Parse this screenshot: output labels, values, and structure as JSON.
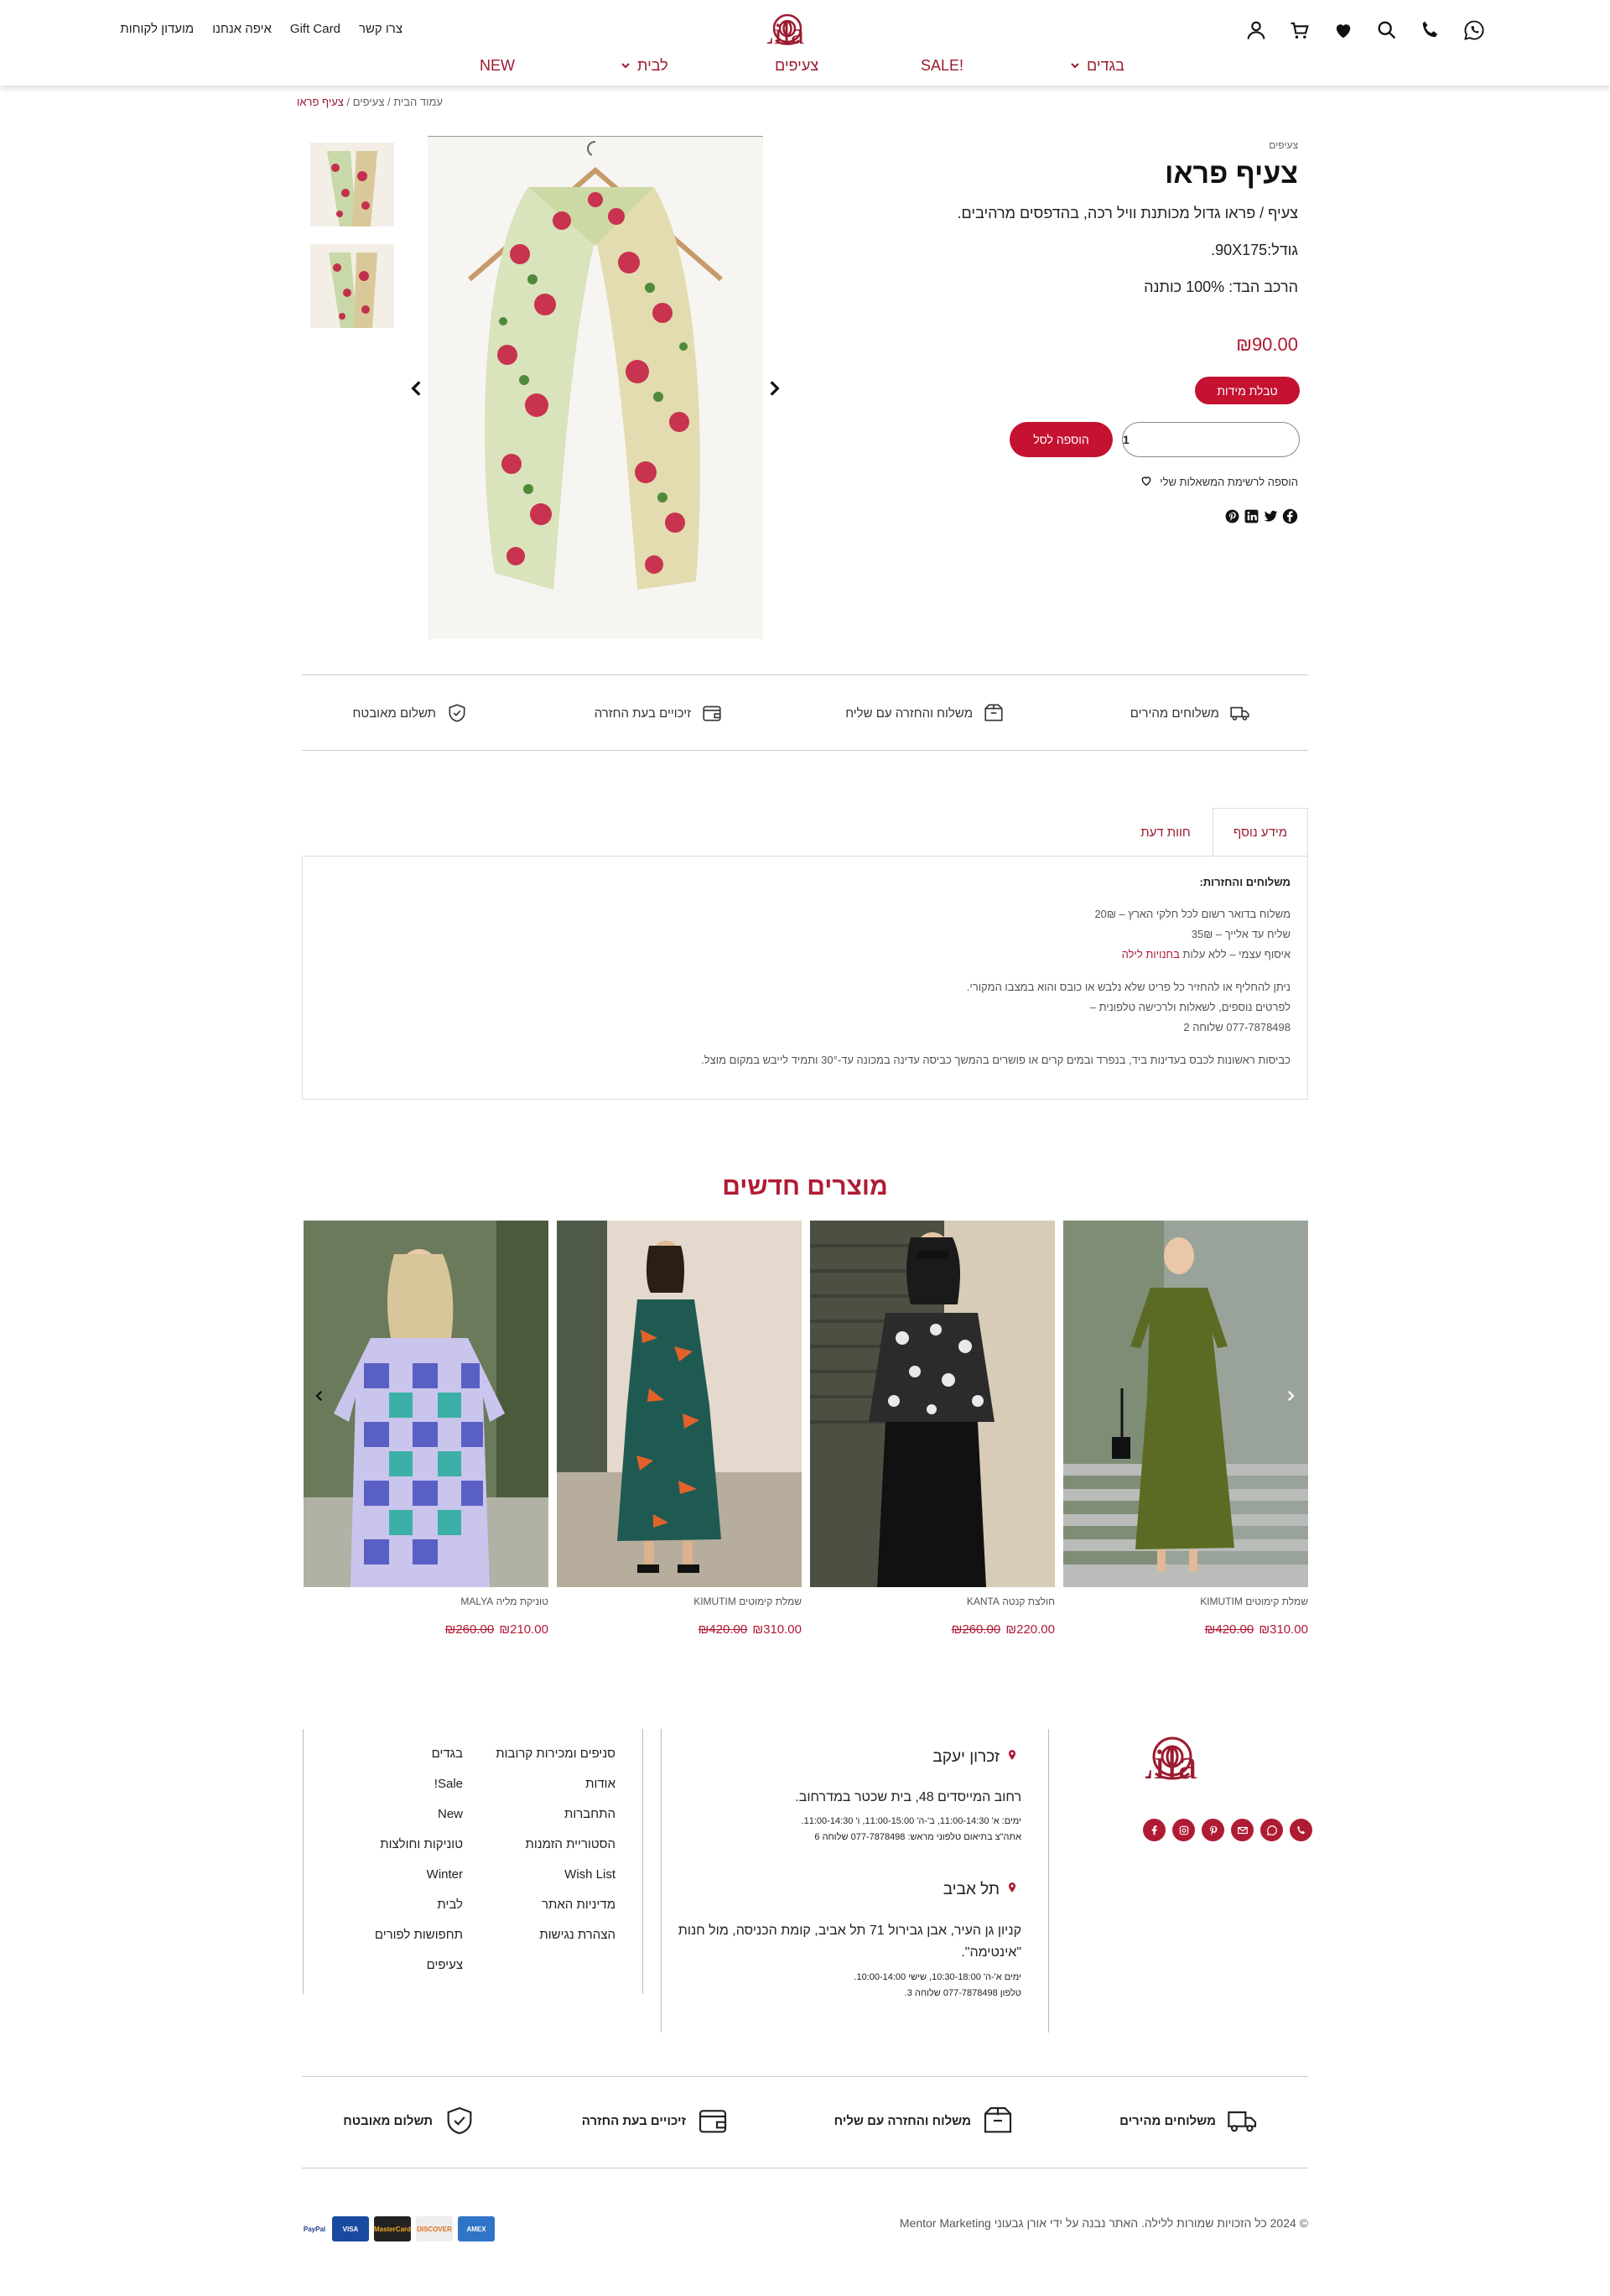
{
  "header": {
    "top_links": [
      "צרו קשר",
      "Gift Card",
      "איפה אנחנו",
      "מועדון לקוחות"
    ],
    "logo_text": "Lila",
    "nav": {
      "clothes": "בגדים",
      "sale": "SALE!",
      "scarves": "צעיפים",
      "lavi": "לבית",
      "new": "NEW"
    }
  },
  "breadcrumb": {
    "home": "עמוד הבית",
    "sep": " / ",
    "category": "צעיפים",
    "current": "צעיף פראו"
  },
  "product": {
    "category": "צעיפים",
    "title": "צעיף פראו",
    "description": "צעיף / פראו גדול מכותנת וויל רכה, בהדפסים מרהיבים.",
    "size": "גודל:90X175.",
    "composition": "הרכב הבד: 100% כותנה",
    "price": "₪90.00",
    "size_chart_label": "טבלת מידות",
    "quantity": "1",
    "add_to_cart_label": "הוספה לסל",
    "wishlist_label": "הוספה לרשימת המשאלות שלי"
  },
  "features": {
    "fast_shipping": "משלוחים מהירים",
    "return_shipping": "משלוח והחזרה עם שליח",
    "return_credit": "זיכויים בעת החזרה",
    "secure_payment": "תשלום מאובטח"
  },
  "tabs": {
    "info": "מידע נוסף",
    "review": "חוות דעת"
  },
  "tab_panel": {
    "heading": "משלוחים והחזרות:",
    "line1": "משלוח בדואר רשום לכל חלקי הארץ – 20₪",
    "line2": "שליח עד אלייך – 35₪",
    "line3_prefix": "איסוף עצמי – ללא עלות ",
    "line3_link": "בחנויות לילה",
    "line4": "ניתן להחליף או להחזיר כל פריט שלא נלבש או כובס והוא במצבו המקורי.",
    "line5": "לפרטים נוספים, לשאלות ולרכישה טלפונית –",
    "line6": "077-7878498 שלוחה 2",
    "line7": "כביסות ראשונות לכבס בעדינות ביד, בנפרד ובמים קרים או פושרים בהמשך כביסה עדינה במכונה עד-30° ותמיד לייבש במקום מוצל."
  },
  "new_products": {
    "title": "מוצרים חדשים",
    "items": [
      {
        "name": "שמלת קימוטים KIMUTIM",
        "old_price": "₪420.00",
        "price": "₪310.00"
      },
      {
        "name": "חולצת קנטה KANTA",
        "old_price": "₪260.00",
        "price": "₪220.00"
      },
      {
        "name": "שמלת קימוטים KIMUTIM",
        "old_price": "₪420.00",
        "price": "₪310.00"
      },
      {
        "name": "טוניקת מליה MALYA",
        "old_price": "₪260.00",
        "price": "₪210.00"
      }
    ]
  },
  "footer": {
    "logo_text": "Lila",
    "zichron": {
      "title": "זכרון יעקב",
      "address": "רחוב המייסדים 48, בית שכטר במדרחוב.",
      "hours": "ימים: א' 11:00-14:30, ב'-ה' 11:00-15:00, ו' 11:00-14:30.",
      "phone": "אתה\"צ בתיאום טלפוני מראש: 077-7878498 שלוחה 6"
    },
    "telaviv": {
      "title": "תל אביב",
      "address1": "קניון גן העיר, אבן גבירול 71 תל אביב, קומת הכניסה, מול חנות",
      "address2": "\"אינטימה\".",
      "hours": "ימים א'-ה' 10:30-18:00, שישי 10:00-14:00.",
      "phone": "טלפון 077-7878498 שלוחה 3."
    },
    "links_col1": [
      "סניפים ומכירות קרובות",
      "אודות",
      "התחברות",
      "הסטוריית הזמנות",
      "Wish List",
      "מדיניות האתר",
      "הצהרת נגישות"
    ],
    "links_col2": [
      "בגדים",
      "Sale!",
      "New",
      "טוניקות וחולצות",
      "Winter",
      "לבית",
      "תחפושות לפורים",
      "צעיפים"
    ],
    "copyright": "© 2024 כל הזכויות שמורות ללילה. האתר נבנה על ידי אורן גבעוני Mentor Marketing",
    "payments": [
      "PayPal",
      "VISA",
      "MasterCard",
      "DISCOVER",
      "AMEX"
    ]
  },
  "colors": {
    "brand": "#b01b34",
    "button": "#c41230"
  }
}
